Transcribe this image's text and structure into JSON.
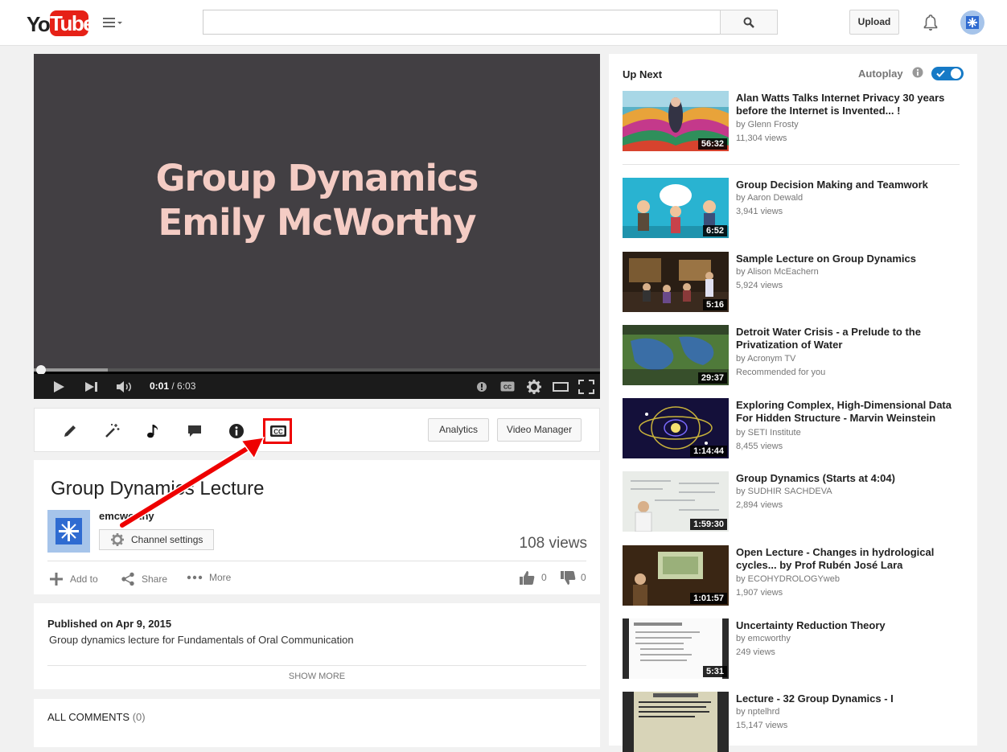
{
  "header": {
    "logo_you": "You",
    "logo_tube": "Tube",
    "search_placeholder": "",
    "upload_label": "Upload"
  },
  "player": {
    "title_line1": "Group Dynamics",
    "title_line2": "Emily McWorthy",
    "current_time": "0:01",
    "duration": "/ 6:03",
    "progress_fraction": 0.003
  },
  "actions": {
    "analytics_label": "Analytics",
    "video_manager_label": "Video Manager"
  },
  "video": {
    "title": "Group Dynamics Lecture",
    "channel_name": "emcworthy",
    "channel_settings_label": "Channel settings",
    "views": "108 views",
    "add_to_label": "Add to",
    "share_label": "Share",
    "more_label": "More",
    "likes": "0",
    "dislikes": "0"
  },
  "description": {
    "published": "Published on Apr 9, 2015",
    "text": "Group dynamics lecture for Fundamentals of Oral Communication",
    "show_more": "SHOW MORE"
  },
  "comments": {
    "title": "ALL COMMENTS",
    "count": "(0)"
  },
  "sidebar": {
    "up_next": "Up Next",
    "autoplay_label": "Autoplay",
    "autoplay_on": true,
    "items": [
      {
        "title": "Alan Watts Talks Internet Privacy 30 years before the Internet is Invented... !",
        "channel": "by Glenn Frosty",
        "views": "11,304 views",
        "duration": "56:32"
      },
      {
        "title": "Group Decision Making and Teamwork",
        "channel": "by Aaron Dewald",
        "views": "3,941 views",
        "duration": "6:52"
      },
      {
        "title": "Sample Lecture on Group Dynamics",
        "channel": "by Alison McEachern",
        "views": "5,924 views",
        "duration": "5:16"
      },
      {
        "title": "Detroit Water Crisis - a Prelude to the Privatization of Water",
        "channel": "by Acronym TV",
        "views": "Recommended for you",
        "duration": "29:37"
      },
      {
        "title": "Exploring Complex, High-Dimensional Data For Hidden Structure - Marvin Weinstein",
        "channel": "by SETI Institute",
        "views": "8,455 views",
        "duration": "1:14:44"
      },
      {
        "title": "Group Dynamics (Starts at 4:04)",
        "channel": "by SUDHIR SACHDEVA",
        "views": "2,894 views",
        "duration": "1:59:30"
      },
      {
        "title": "Open Lecture - Changes in hydrological cycles... by Prof Rubén José Lara",
        "channel": "by ECOHYDROLOGYweb",
        "views": "1,907 views",
        "duration": "1:01:57"
      },
      {
        "title": "Uncertainty Reduction Theory",
        "channel": "by emcworthy",
        "views": "249 views",
        "duration": "5:31"
      },
      {
        "title": "Lecture - 32 Group Dynamics - I",
        "channel": "by nptelhrd",
        "views": "15,147 views",
        "duration": ""
      }
    ]
  },
  "colors": {
    "brand_red": "#e62117",
    "accent_blue": "#167ac6",
    "annotation_red": "#e00000"
  }
}
